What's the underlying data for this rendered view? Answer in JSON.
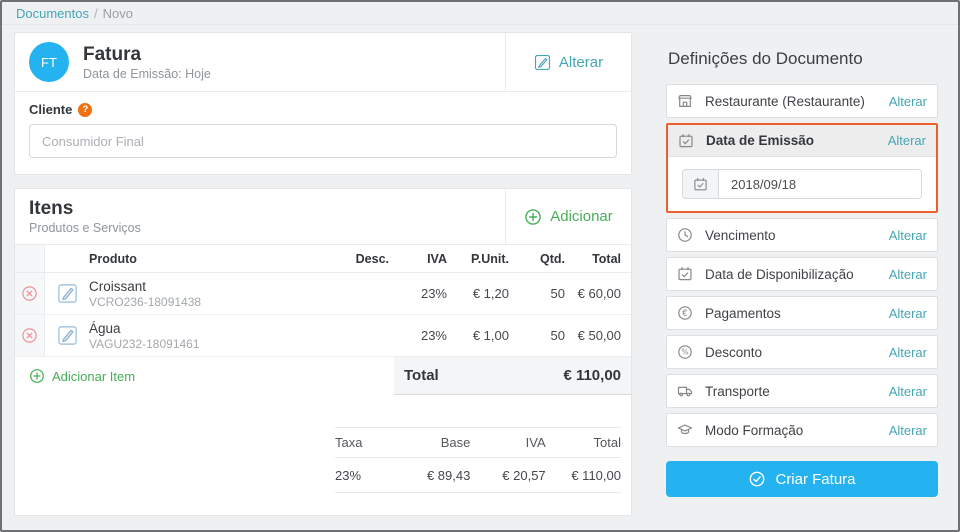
{
  "breadcrumb": {
    "items": [
      "Documentos",
      "Novo"
    ],
    "separator": "/"
  },
  "document_card": {
    "type_badge": "FT",
    "title": "Fatura",
    "subtitle": "Data de Emissão: Hoje",
    "change_label": "Alterar",
    "client": {
      "label": "Cliente",
      "placeholder": "Consumidor Final"
    }
  },
  "items_card": {
    "title": "Itens",
    "subtitle": "Produtos e Serviços",
    "add_label": "Adicionar",
    "table": {
      "headers": {
        "produto": "Produto",
        "desc": "Desc.",
        "iva": "IVA",
        "punit": "P.Unit.",
        "qtd": "Qtd.",
        "total": "Total"
      },
      "rows": [
        {
          "name": "Croissant",
          "code": "VCRO236-18091438",
          "desc": "",
          "iva": "23%",
          "punit": "€ 1,20",
          "qtd": "50",
          "total": "€ 60,00"
        },
        {
          "name": "Água",
          "code": "VAGU232-18091461",
          "desc": "",
          "iva": "23%",
          "punit": "€ 1,00",
          "qtd": "50",
          "total": "€ 50,00"
        }
      ]
    },
    "add_item_label": "Adicionar Item",
    "total_label": "Total",
    "total_value": "€ 110,00",
    "tax_table": {
      "headers": {
        "taxa": "Taxa",
        "base": "Base",
        "iva": "IVA",
        "total": "Total"
      },
      "row": {
        "taxa": "23%",
        "base": "€ 89,43",
        "iva": "€ 20,57",
        "total": "€ 110,00"
      }
    }
  },
  "settings_panel": {
    "title": "Definições do Documento",
    "change_label": "Alterar",
    "items": [
      {
        "label": "Restaurante (Restaurante)",
        "icon": "storefront-icon"
      },
      {
        "label": "Data de Emissão",
        "icon": "calendar-icon",
        "highlighted": true,
        "date_value": "2018/09/18"
      },
      {
        "label": "Vencimento",
        "icon": "clock-icon"
      },
      {
        "label": "Data de Disponibilização",
        "icon": "calendar-icon"
      },
      {
        "label": "Pagamentos",
        "icon": "euro-icon"
      },
      {
        "label": "Desconto",
        "icon": "percent-icon"
      },
      {
        "label": "Transporte",
        "icon": "truck-icon"
      },
      {
        "label": "Modo Formação",
        "icon": "graduation-cap-icon"
      }
    ],
    "submit_label": "Criar Fatura"
  },
  "colors": {
    "accent_blue": "#24b3f0",
    "link_teal": "#46a5b5",
    "green": "#47ad58",
    "highlight_orange": "#e8612c",
    "help_orange": "#ee7211",
    "delete_pink": "#ee919b",
    "edit_blue": "#a5c6e2",
    "page_background": "#eef0f2"
  }
}
